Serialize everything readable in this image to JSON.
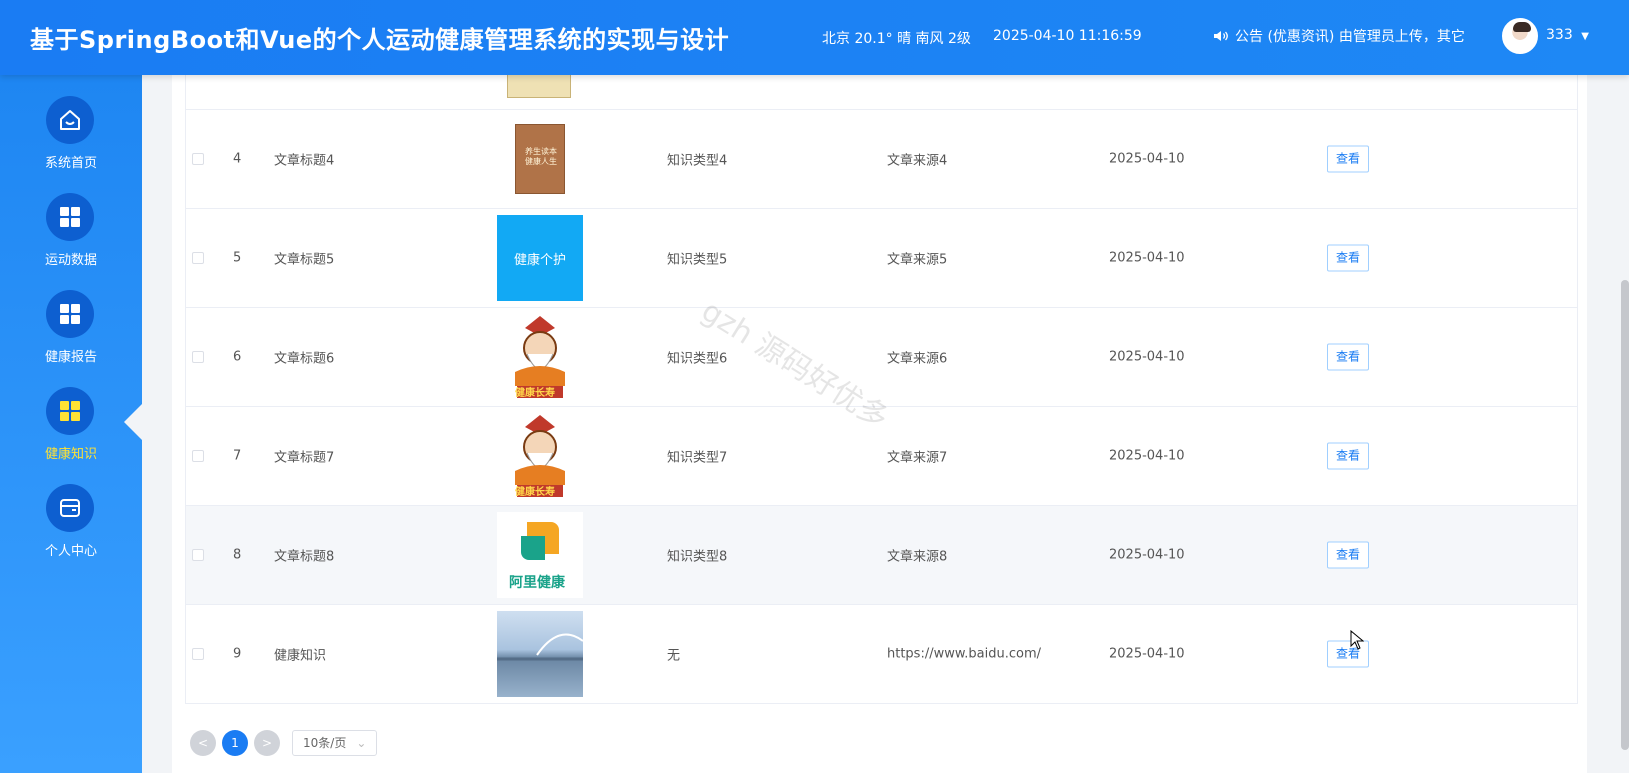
{
  "header": {
    "title": "基于SpringBoot和Vue的个人运动健康管理系统的实现与设计",
    "weather": "北京 20.1° 晴 南风 2级",
    "datetime": "2025-04-10 11:16:59",
    "notice": "公告 (优惠资讯) 由管理员上传，其它",
    "user": "333"
  },
  "sidebar": {
    "items": [
      {
        "label": "系统首页",
        "icon": "home-icon"
      },
      {
        "label": "运动数据",
        "icon": "grid-icon"
      },
      {
        "label": "健康报告",
        "icon": "grid-icon"
      },
      {
        "label": "健康知识",
        "icon": "grid-icon",
        "active": true
      },
      {
        "label": "个人中心",
        "icon": "wallet-icon"
      }
    ]
  },
  "table": {
    "rows": [
      {
        "idx": "4",
        "title": "文章标题4",
        "type": "知识类型4",
        "source": "文章来源4",
        "date": "2025-04-10",
        "thumb_text": "养生读本 健康人生"
      },
      {
        "idx": "5",
        "title": "文章标题5",
        "type": "知识类型5",
        "source": "文章来源5",
        "date": "2025-04-10",
        "thumb_text": "健康个护"
      },
      {
        "idx": "6",
        "title": "文章标题6",
        "type": "知识类型6",
        "source": "文章来源6",
        "date": "2025-04-10",
        "thumb_text": "健康长寿"
      },
      {
        "idx": "7",
        "title": "文章标题7",
        "type": "知识类型7",
        "source": "文章来源7",
        "date": "2025-04-10",
        "thumb_text": "健康长寿"
      },
      {
        "idx": "8",
        "title": "文章标题8",
        "type": "知识类型8",
        "source": "文章来源8",
        "date": "2025-04-10",
        "thumb_text": "阿里健康"
      },
      {
        "idx": "9",
        "title": "健康知识",
        "type": "无",
        "source": "https://www.baidu.com/",
        "date": "2025-04-10",
        "thumb_text": ""
      }
    ],
    "view_label": "查看"
  },
  "pager": {
    "prev": "<",
    "current": "1",
    "next": ">",
    "page_size": "10条/页"
  },
  "watermark": "gzh 源码好优多"
}
